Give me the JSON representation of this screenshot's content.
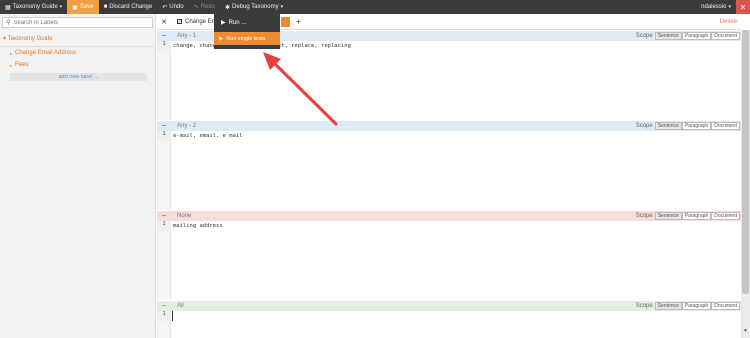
{
  "topbar": {
    "taxonomy_guide": "Taxonomy Guide",
    "save": "Save",
    "discard": "Discard Change",
    "undo": "Undo",
    "redo": "Redo",
    "debug": "Debug Taxonomy",
    "user": "ndalessio",
    "close": "✕"
  },
  "sidebar": {
    "search_placeholder": "Search in Labels",
    "root": "Taxonomy Guide",
    "items": [
      {
        "label": "Change Email Address"
      },
      {
        "label": "Fees"
      }
    ],
    "add_label": "add new label ..."
  },
  "tabs": {
    "current": "Change Emi",
    "delete": "Delete"
  },
  "dropdown": {
    "run": "Run ...",
    "run_single": "Run single tests"
  },
  "scope": {
    "label": "Scope",
    "options": [
      "Sentence",
      "Paragraph",
      "Document"
    ]
  },
  "sections": [
    {
      "title": "Any - 1",
      "line_no": "1",
      "text": "change, changi",
      "text_tail": "just, replace, replacing",
      "color": "#dcebf5"
    },
    {
      "title": "Any - 2",
      "line_no": "1",
      "text": "e-mail, email, e mail",
      "color": "#dcebf5"
    },
    {
      "title": "None",
      "line_no": "1",
      "text": "mailing address",
      "color": "#f6dcdc"
    },
    {
      "title": "All",
      "line_no": "1",
      "text": "",
      "color": "#e2f0db"
    }
  ],
  "colors": {
    "accent": "#f08a30",
    "topbar": "#3b3b3b",
    "annotation_arrow": "#e8403a"
  }
}
